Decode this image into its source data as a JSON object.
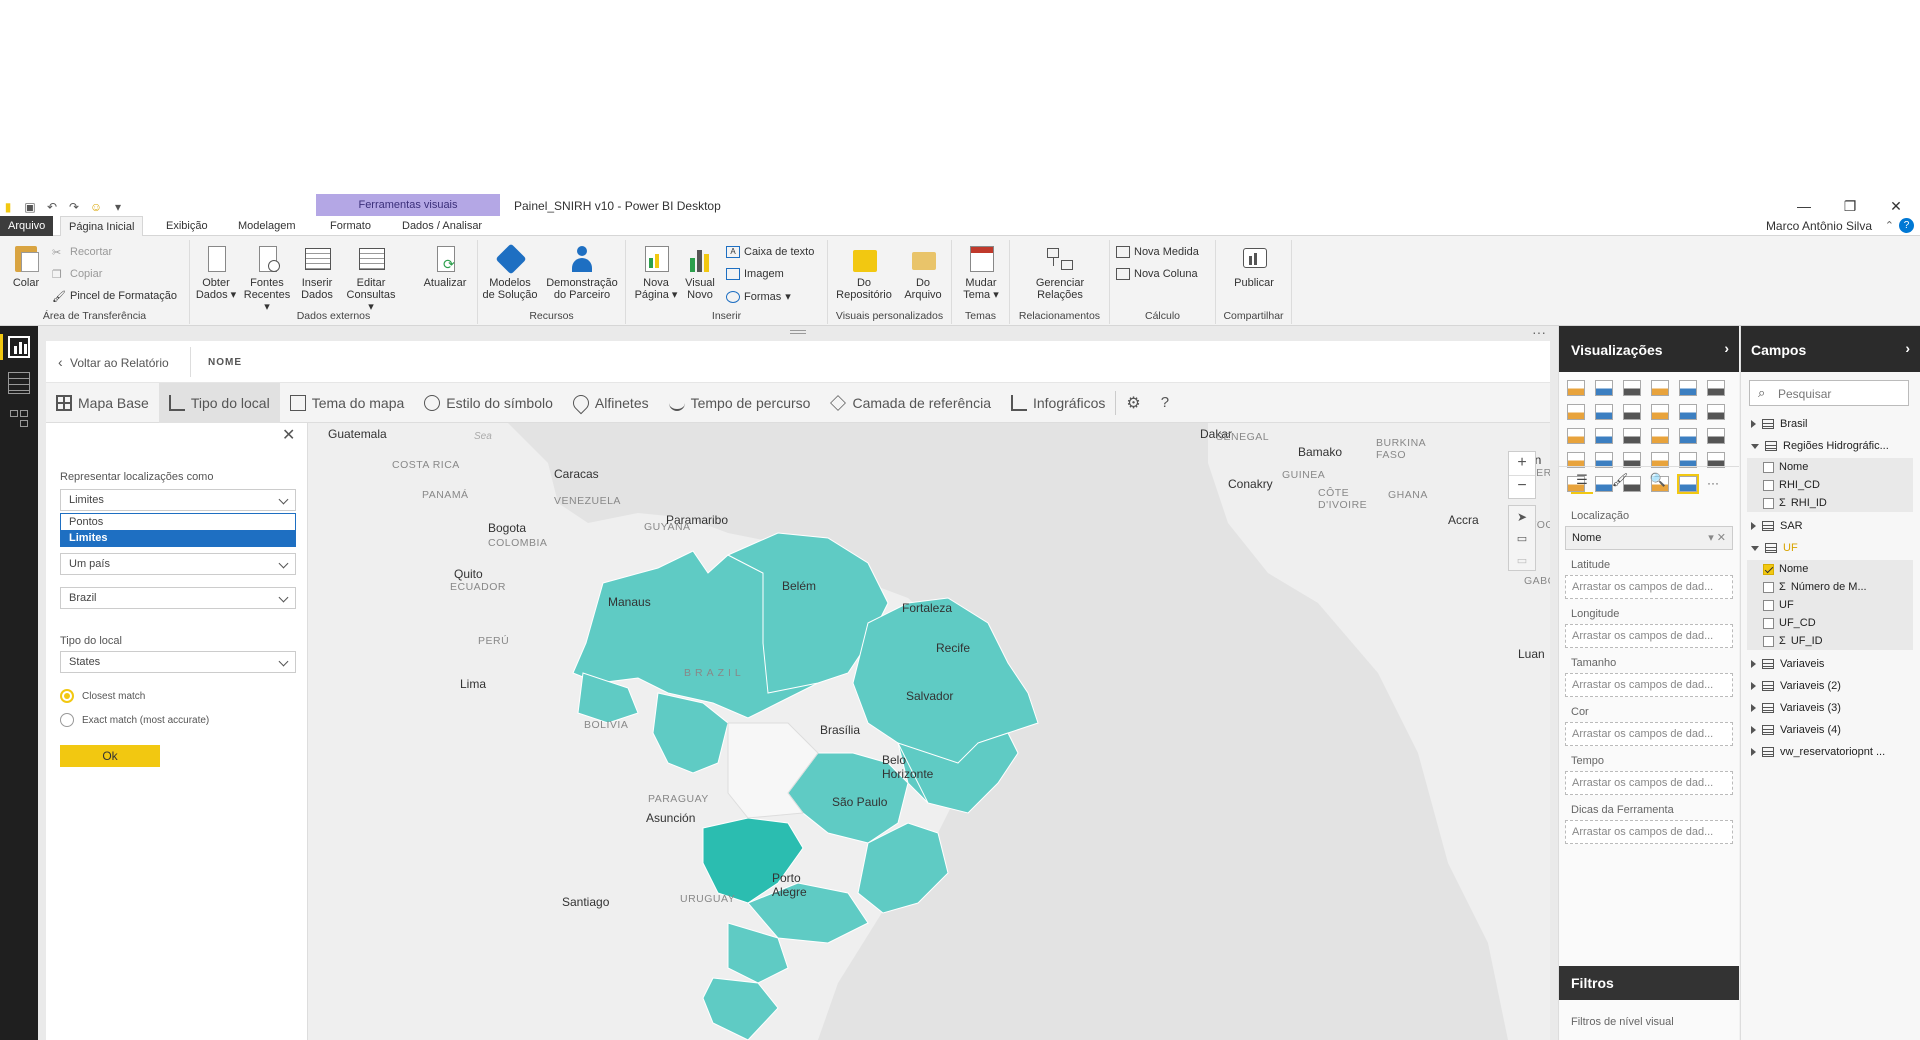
{
  "window": {
    "title": "Painel_SNIRH v10 - Power BI Desktop",
    "context_group": "Ferramentas visuais",
    "user": "Marco Antônio Silva"
  },
  "tabs": [
    "Arquivo",
    "Página Inicial",
    "Exibição",
    "Modelagem",
    "Formato",
    "Dados / Analisar"
  ],
  "ribbon": {
    "clipboard": {
      "paste": "Colar",
      "cut": "Recortar",
      "copy": "Copiar",
      "format_painter": "Pincel de Formatação",
      "group": "Área de Transferência"
    },
    "external": {
      "get_data": "Obter Dados",
      "recent_sources": "Fontes Recentes",
      "enter_data": "Inserir Dados",
      "edit_queries": "Editar Consultas",
      "refresh": "Atualizar",
      "group": "Dados externos"
    },
    "resources": {
      "solution_templates": "Modelos de Solução",
      "partner_showcase": "Demonstração do Parceiro",
      "group": "Recursos"
    },
    "insert": {
      "new_page": "Nova Página",
      "new_visual": "Visual Novo",
      "text_box": "Caixa de texto",
      "image": "Imagem",
      "shapes": "Formas",
      "group": "Inserir"
    },
    "custom_visuals": {
      "from_store": "Do Repositório",
      "from_file": "Do Arquivo",
      "group": "Visuais personalizados"
    },
    "themes": {
      "switch_theme": "Mudar Tema",
      "group": "Temas"
    },
    "relationships": {
      "manage": "Gerenciar Relações",
      "group": "Relacionamentos"
    },
    "calculations": {
      "new_measure": "Nova Medida",
      "new_column": "Nova Coluna",
      "group": "Cálculo"
    },
    "share": {
      "publish": "Publicar",
      "group": "Compartilhar"
    }
  },
  "focus": {
    "back": "Voltar ao Relatório",
    "visual_name": "NOME"
  },
  "map_toolbar": [
    "Mapa Base",
    "Tipo do local",
    "Tema do mapa",
    "Estilo do símbolo",
    "Alfinetes",
    "Tempo de percurso",
    "Camada de referência",
    "Infográficos"
  ],
  "panel": {
    "represent_label": "Representar localizações como",
    "represent_value": "Limites",
    "dropdown_options": [
      "Pontos",
      "Limites"
    ],
    "scope_value": "Um país",
    "country_value": "Brazil",
    "location_type_label": "Tipo do local",
    "location_type_value": "States",
    "radio_closest": "Closest match",
    "radio_exact": "Exact match (most accurate)",
    "ok": "Ok"
  },
  "map_labels": {
    "cities": [
      "Guatemala",
      "Caracas",
      "Paramaribo",
      "Bogota",
      "Quito",
      "Manaus",
      "Belém",
      "Fortaleza",
      "Recife",
      "Salvador",
      "Lima",
      "Brasília",
      "Belo Horizonte",
      "São Paulo",
      "Asunción",
      "Porto Alegre",
      "Santiago",
      "Dakar",
      "Bamako",
      "Conakry",
      "Accra",
      "Luan"
    ],
    "countries": [
      "COSTA RICA",
      "PANAMÁ",
      "VENEZUELA",
      "GUYANA",
      "COLOMBIA",
      "ECUADOR",
      "PERÚ",
      "BRAZIL",
      "BOLIVIA",
      "PARAGUAY",
      "URUGUAY",
      "SENEGAL",
      "BURKINA FASO",
      "GUINEA",
      "CÔTE D'IVOIRE",
      "GHANA",
      "GABON",
      "NIGER",
      "TOGO"
    ],
    "sea": "Sea",
    "kano": "Kan"
  },
  "visualizations": {
    "title": "Visualizações",
    "wells": [
      {
        "label": "Localização",
        "value": "Nome"
      },
      {
        "label": "Latitude",
        "value": "Arrastar os campos de dad..."
      },
      {
        "label": "Longitude",
        "value": "Arrastar os campos de dad..."
      },
      {
        "label": "Tamanho",
        "value": "Arrastar os campos de dad..."
      },
      {
        "label": "Cor",
        "value": "Arrastar os campos de dad..."
      },
      {
        "label": "Tempo",
        "value": "Arrastar os campos de dad..."
      },
      {
        "label": "Dicas da Ferramenta",
        "value": "Arrastar os campos de dad..."
      }
    ],
    "filters_title": "Filtros",
    "filters_visual": "Filtros de nível visual"
  },
  "fields": {
    "title": "Campos",
    "search_placeholder": "Pesquisar",
    "tables": [
      "Brasil",
      "Regiões Hidrográfic...",
      "SAR",
      "UF",
      "Variaveis",
      "Variaveis (2)",
      "Variaveis (3)",
      "Variaveis (4)",
      "vw_reservatoriopnt ..."
    ],
    "rhi_fields": [
      "Nome",
      "RHI_CD",
      "RHI_ID"
    ],
    "uf_fields": [
      "Nome",
      "Número de M...",
      "UF",
      "UF_CD",
      "UF_ID"
    ],
    "sigma": "Σ"
  },
  "colors": {
    "accent": "#f2c811",
    "states": "#5fcbc4",
    "selected_state": "#2bbdb0",
    "dark": "#2b2b2b"
  }
}
